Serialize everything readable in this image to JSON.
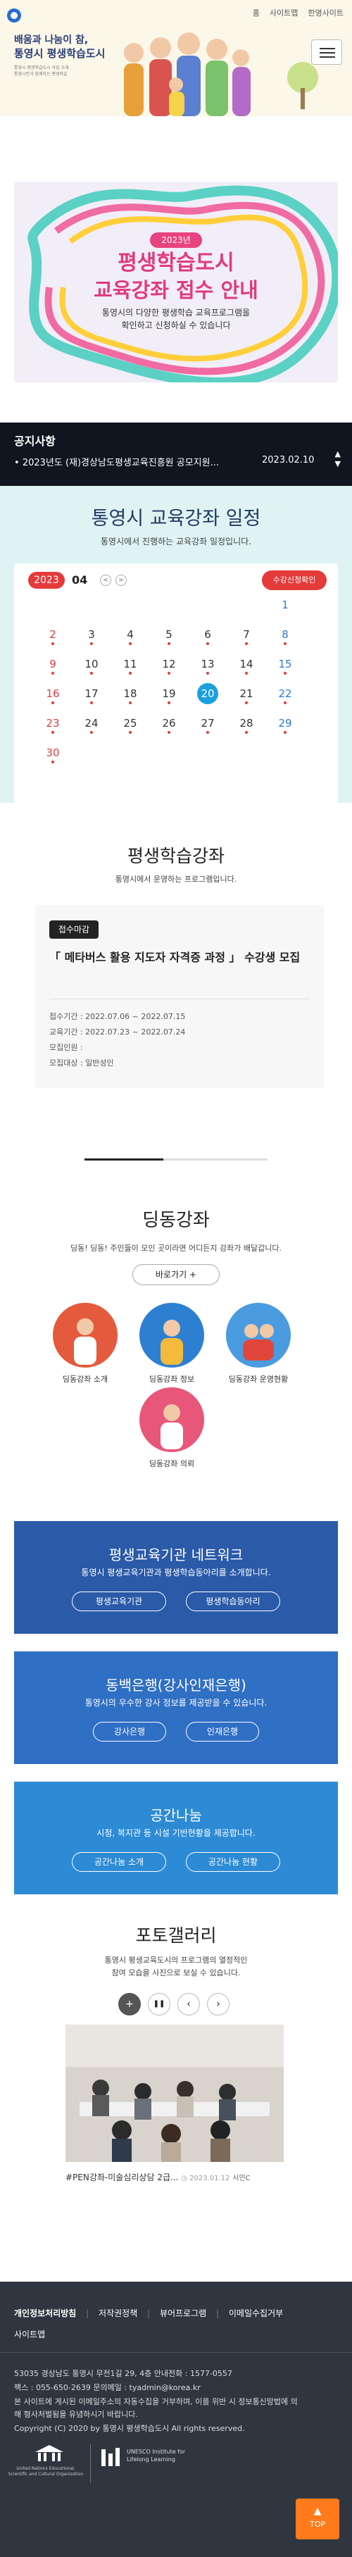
{
  "util": {
    "home": "홈",
    "sitemap": "사이트맵",
    "site": "한영사이트"
  },
  "header": {
    "line1": "배움과 나눔이 참,",
    "line2": "통영시 평생학습도시",
    "small1": "통영시 평생학습도시 사업 소개",
    "small2": "통영시민과 함께하는 평생학습"
  },
  "banner": {
    "year": "2023년",
    "title1": "평생학습도시",
    "title2": "교육강좌 접수 안내",
    "desc1": "통영시의 다양한 평생학습 교육프로그램을",
    "desc2": "확인하고 신청하실 수 있습니다"
  },
  "notice": {
    "title": "공지사항",
    "item": "2023년도 (재)경상남도평생교육진흥원 공모지원...",
    "date": "2023.02.10",
    "bullet": "•"
  },
  "calendar": {
    "title": "통영시 교육강좌 일정",
    "subtitle": "통영시에서 진행하는 교육강좌 일정입니다.",
    "year": "2023",
    "month": "04",
    "prev": "<",
    "next": ">",
    "apply": "수강신청확인",
    "today": "20",
    "event_days": [
      "2",
      "3",
      "4",
      "5",
      "6",
      "7",
      "8",
      "9",
      "10",
      "11",
      "12",
      "13",
      "14",
      "15",
      "16",
      "17",
      "18",
      "19",
      "21",
      "22",
      "23",
      "24",
      "25",
      "26",
      "27",
      "28",
      "29",
      "30"
    ]
  },
  "course": {
    "title": "평생학습강좌",
    "subtitle": "통영시에서 운영하는 프로그램입니다.",
    "badge": "접수마감",
    "name": "「 메타버스 활용 지도자 자격증 과정 」 수강생 모집",
    "period": "접수기간 : 2022.07.06 ~ 2022.07.15",
    "edu": "교육기간 : 2022.07.23 ~ 2022.07.24",
    "people": "모집인원 :",
    "target": "모집대상 : 일반성인",
    "current": "3",
    "total": "7",
    "progress": 0.43
  },
  "digdong": {
    "title": "딩동강좌",
    "subtitle": "딩동! 딩동! 주민들이 모인 곳이라면 어디든지 강좌가 배달갑니다.",
    "button": "바로가기 +",
    "items": [
      "딩동강좌 소개",
      "딩동강좌 정보",
      "딩동강좌 운영현황",
      "딩동강좌 의뢰"
    ]
  },
  "network": {
    "title": "평생교육기관 네트워크",
    "subtitle": "통영시 평생교육기관과 평생학습동아리를 소개합니다.",
    "btn1": "평생교육기관",
    "btn2": "평생학습동아리",
    "color": "#2a5aa8"
  },
  "dongbaek": {
    "title": "동백은행(강사인재은행)",
    "subtitle": "통영시의 우수한 강사 정보를 제공받을 수 있습니다.",
    "btn1": "강사은행",
    "btn2": "인재은행",
    "color": "#2f6fc4"
  },
  "space": {
    "title": "공간나눔",
    "subtitle": "시청, 복지관 등 시설 기반현황을 제공합니다.",
    "btn1": "공간나눔 소개",
    "btn2": "공간나눔 현황",
    "color": "#2d8bd6"
  },
  "gallery": {
    "title": "포토갤러리",
    "sub1": "통영시 평생교육도시의 프로그램의 열정적인",
    "sub2": "참여 모습을 사진으로 보실 수 있습니다.",
    "caption": "#PEN강좌-미술심리상담 2급...",
    "date": "2023.01.12",
    "writer": "시민C"
  },
  "footer": {
    "links": [
      "개인정보처리방침",
      "저작권정책",
      "뷰어프로그램",
      "이메일수집거부",
      "사이트맵"
    ],
    "addr": "53035 경상남도 통영시 무전1길 29, 4층   안내전화 : 1577-0557",
    "fax": "팩스 : 055-650-2639   문의메일 : tyadmin@korea.kr",
    "notice": "본 사이트에 게시된 이메일주소의 자동수집을 거부하며, 이를 위반 시 정보통신망법에 의",
    "notice2": "해 형사처벌됨을 유념하시기 바랍니다.",
    "copy": "Copyright (C) 2020 by 통영시 평생학습도시 All rights reserved.",
    "unesco": "United Nations Educational, Scientific and Cultural Organization",
    "uil": "UNESCO Institute for Lifelong Learning",
    "top": "TOP"
  }
}
